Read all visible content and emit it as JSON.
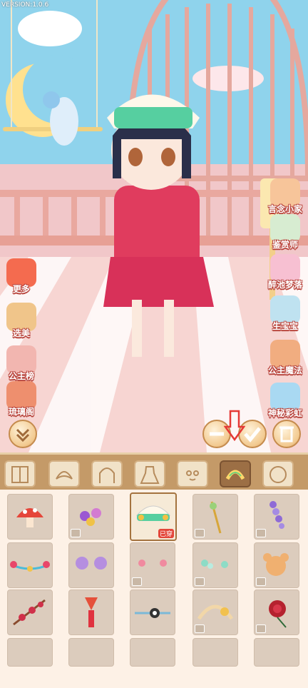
{
  "version_label": "VERSION:1.0.6",
  "left_menu": [
    {
      "label": "更多",
      "icon": "gift-icon"
    },
    {
      "label": "选美",
      "icon": "fan-icon"
    },
    {
      "label": "公主榜",
      "icon": "trophy-icon"
    },
    {
      "label": "琉璃阁",
      "icon": "pavilion-icon"
    }
  ],
  "right_menu": [
    {
      "label": "言念小家",
      "icon": "house-icon"
    },
    {
      "label": "鉴赏师",
      "icon": "bird-icon"
    },
    {
      "label": "醉池梦落",
      "icon": "lotus-icon"
    },
    {
      "label": "生宝宝",
      "icon": "baby-icon"
    },
    {
      "label": "公主魔法",
      "icon": "princess-icon"
    },
    {
      "label": "神秘彩虹",
      "icon": "rainbow-icon"
    }
  ],
  "category_tabs": [
    {
      "name": "wardrobe",
      "selected": false
    },
    {
      "name": "hair-front",
      "selected": false
    },
    {
      "name": "hair-back",
      "selected": false
    },
    {
      "name": "dress",
      "selected": false
    },
    {
      "name": "face",
      "selected": false
    },
    {
      "name": "hair-accessory",
      "selected": true
    },
    {
      "name": "head",
      "selected": false
    }
  ],
  "items": [
    {
      "name": "mushroom-clip"
    },
    {
      "name": "flower-pins"
    },
    {
      "name": "headscarf",
      "selected": true,
      "tag": "已穿"
    },
    {
      "name": "gold-hairpin"
    },
    {
      "name": "purple-wisteria"
    },
    {
      "name": "bead-chain"
    },
    {
      "name": "purple-bows"
    },
    {
      "name": "pink-flowers"
    },
    {
      "name": "jade-pins"
    },
    {
      "name": "mouse-clip"
    },
    {
      "name": "plum-branch"
    },
    {
      "name": "fox-tassel"
    },
    {
      "name": "yin-yang-pin"
    },
    {
      "name": "flower-crown"
    },
    {
      "name": "red-rose"
    }
  ],
  "colors": {
    "accent": "#c49a68",
    "selected_tab": "#9c6f45",
    "label_outline": "#b8443c"
  }
}
